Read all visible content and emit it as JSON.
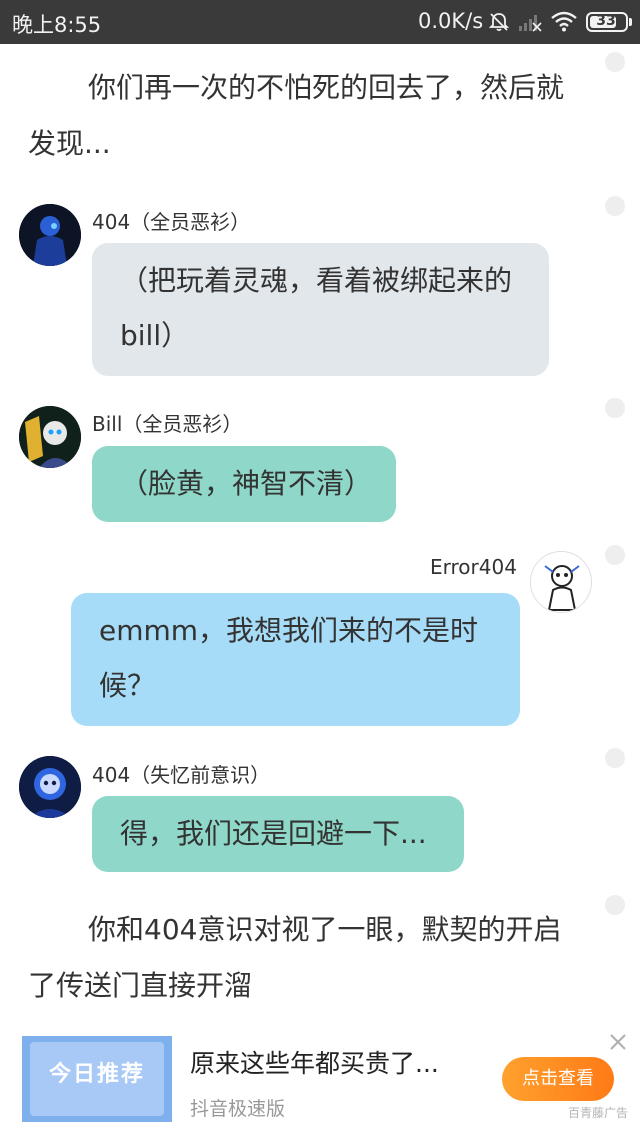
{
  "status_bar": {
    "time": "晚上8:55",
    "network_speed": "0.0K/s",
    "battery": "33",
    "icons": [
      "bell-muted-icon",
      "signal-icon",
      "wifi-icon",
      "battery-icon"
    ]
  },
  "story": {
    "narration_1": "你们再一次的不怕死的回去了，然后就发现...",
    "messages": [
      {
        "sender": "404（全员恶衫）",
        "text": "（把玩着灵魂，看着被绑起来的bill）"
      },
      {
        "sender": "Bill（全员恶衫）",
        "text": "（脸黄，神智不清）"
      },
      {
        "sender": "Error404",
        "text": "emmm，我想我们来的不是时候？"
      },
      {
        "sender": "404（失忆前意识）",
        "text": "得，我们还是回避一下..."
      }
    ],
    "narration_2": "你和404意识对视了一眼，默契的开启了传送门直接开溜"
  },
  "ad": {
    "thumbnail_text": "今日推荐",
    "title": "原来这些年都买贵了...",
    "source": "抖音极速版",
    "button_label": "点击查看",
    "tag": "百青藤广告"
  },
  "colors": {
    "status_bar": "#3a3a3a",
    "bubble_gray": "#e2e7ec",
    "bubble_teal": "#8ed7c9",
    "bubble_blue": "#a6dcf7",
    "ad_button": "#ff8a20"
  }
}
